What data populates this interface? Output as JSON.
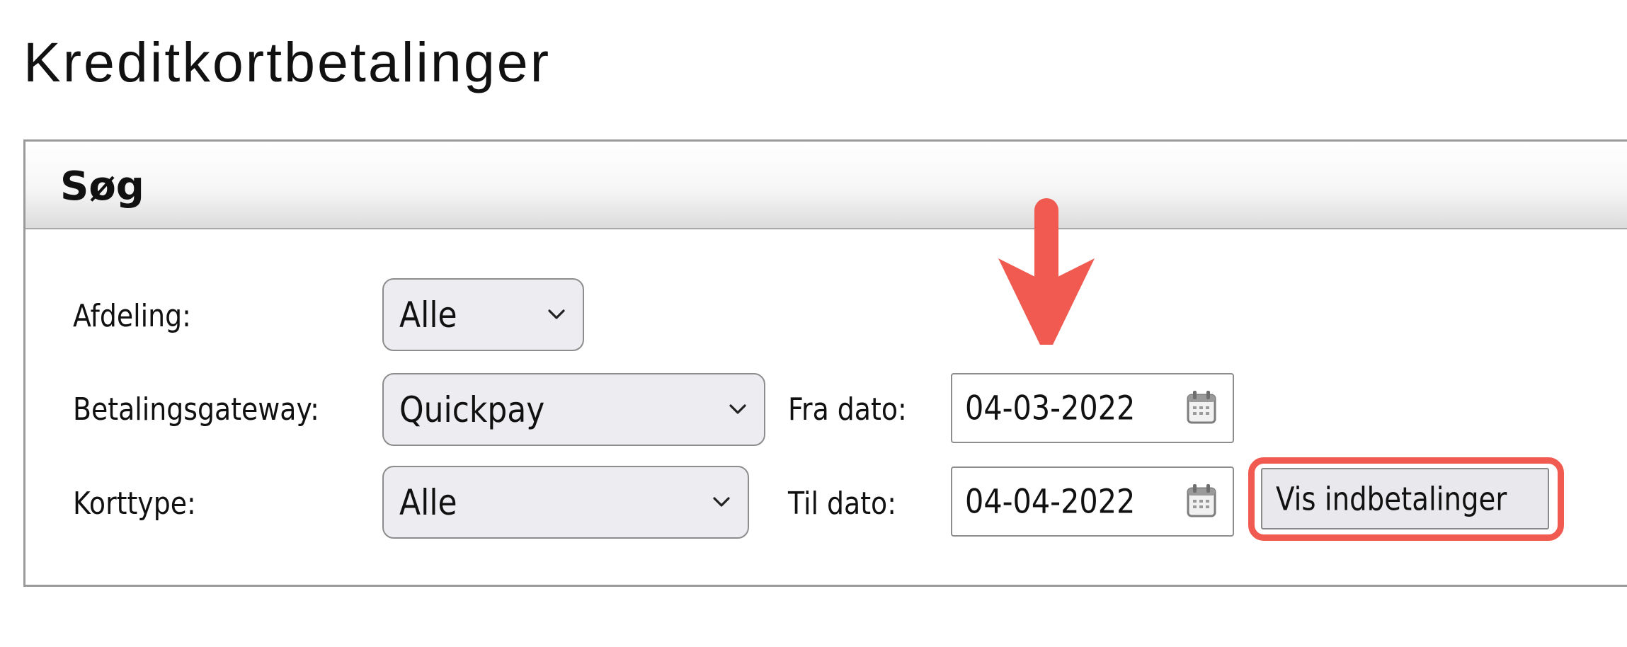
{
  "page": {
    "title": "Kreditkortbetalinger"
  },
  "search_panel": {
    "title": "Søg",
    "fields": {
      "afdeling": {
        "label": "Afdeling:",
        "value": "Alle"
      },
      "betalingsgateway": {
        "label": "Betalingsgateway:",
        "value": "Quickpay"
      },
      "korttype": {
        "label": "Korttype:",
        "value": "Alle"
      },
      "fra_dato": {
        "label": "Fra dato:",
        "value": "04-03-2022"
      },
      "til_dato": {
        "label": "Til dato:",
        "value": "04-04-2022"
      }
    },
    "submit_label": "Vis indbetalinger"
  },
  "annotations": {
    "highlight_color": "#f05a50",
    "arrow_target": "fra-dato-field",
    "highlighted_element": "vis-indbetalinger-button"
  },
  "icons": {
    "dropdown": "chevron-down-icon",
    "date_picker": "calendar-icon"
  }
}
